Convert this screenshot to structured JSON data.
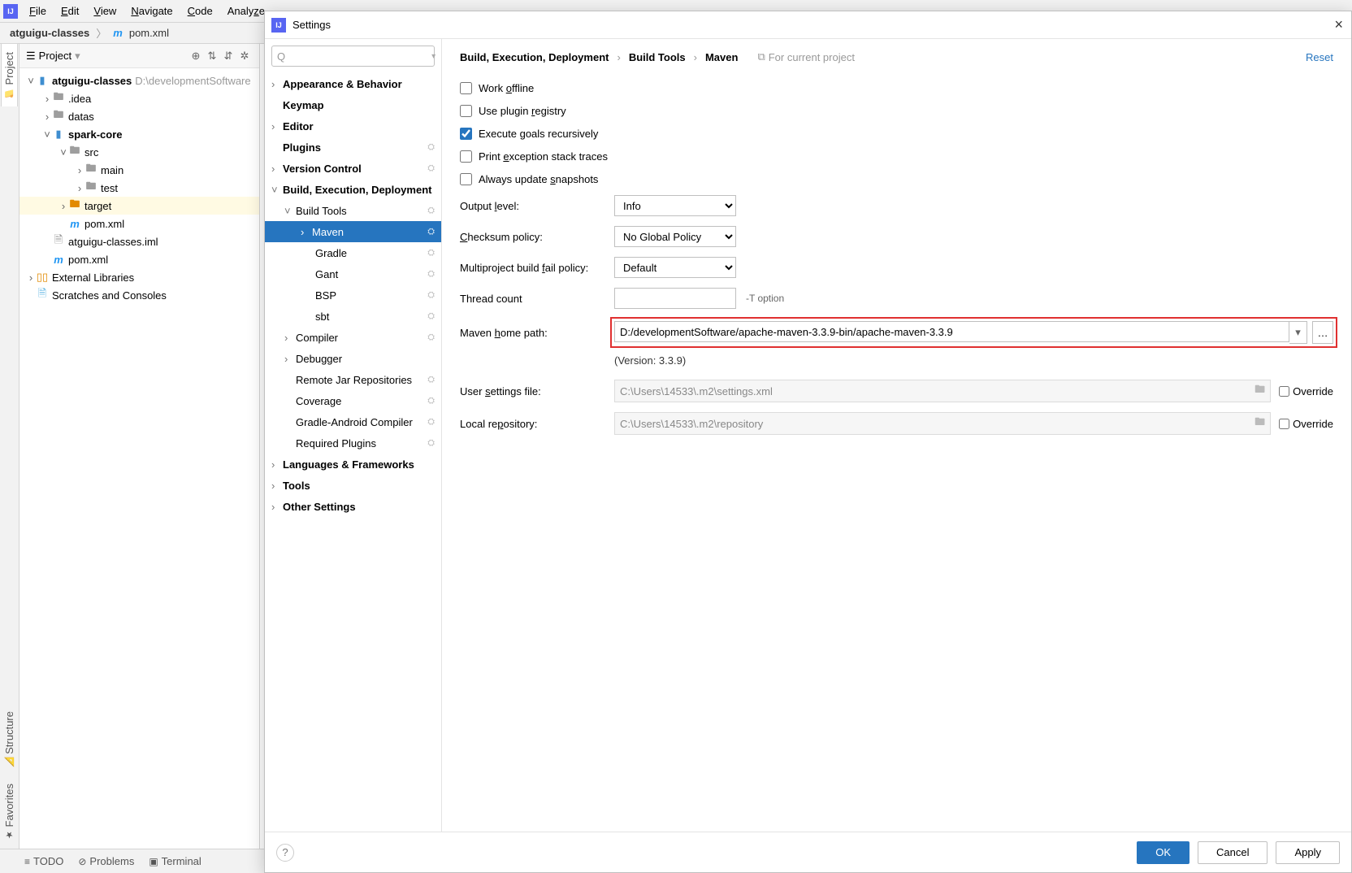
{
  "menubar": {
    "items": [
      "File",
      "Edit",
      "View",
      "Navigate",
      "Code",
      "Analyze"
    ]
  },
  "breadcrumb": {
    "project": "atguigu-classes",
    "file": "pom.xml"
  },
  "left_tabs": {
    "project": "Project",
    "structure": "Structure",
    "favorites": "Favorites"
  },
  "project_panel": {
    "title": "Project",
    "tree": {
      "root": "atguigu-classes",
      "root_path": "D:\\developmentSoftware",
      "idea": ".idea",
      "datas": "datas",
      "spark_core": "spark-core",
      "src": "src",
      "main": "main",
      "test": "test",
      "target": "target",
      "pom1": "pom.xml",
      "iml": "atguigu-classes.iml",
      "pom2": "pom.xml",
      "ext_lib": "External Libraries",
      "scratches": "Scratches and Consoles"
    }
  },
  "bottom": {
    "todo": "TODO",
    "problems": "Problems",
    "terminal": "Terminal"
  },
  "dialog": {
    "title": "Settings",
    "search_placeholder": "",
    "reset": "Reset",
    "proj_hint": "For current project",
    "crumbs": [
      "Build, Execution, Deployment",
      "Build Tools",
      "Maven"
    ],
    "tree": {
      "appearance": "Appearance & Behavior",
      "keymap": "Keymap",
      "editor": "Editor",
      "plugins": "Plugins",
      "vcs": "Version Control",
      "bed": "Build, Execution, Deployment",
      "build_tools": "Build Tools",
      "maven": "Maven",
      "gradle": "Gradle",
      "gant": "Gant",
      "bsp": "BSP",
      "sbt": "sbt",
      "compiler": "Compiler",
      "debugger": "Debugger",
      "remote_jar": "Remote Jar Repositories",
      "coverage": "Coverage",
      "gradle_android": "Gradle-Android Compiler",
      "required_plugins": "Required Plugins",
      "langs": "Languages & Frameworks",
      "tools": "Tools",
      "other": "Other Settings"
    },
    "checks": {
      "offline": "Work offline",
      "registry": "Use plugin registry",
      "recursive": "Execute goals recursively",
      "exception": "Print exception stack traces",
      "snapshots": "Always update snapshots"
    },
    "fields": {
      "output_level_label": "Output level:",
      "output_level": "Info",
      "checksum_label": "Checksum policy:",
      "checksum": "No Global Policy",
      "failpolicy_label": "Multiproject build fail policy:",
      "failpolicy": "Default",
      "thread_label": "Thread count",
      "thread": "",
      "thread_hint": "-T option",
      "maven_home_label": "Maven home path:",
      "maven_home": "D:/developmentSoftware/apache-maven-3.3.9-bin/apache-maven-3.3.9",
      "version": "(Version: 3.3.9)",
      "user_settings_label": "User settings file:",
      "user_settings": "C:\\Users\\14533\\.m2\\settings.xml",
      "local_repo_label": "Local repository:",
      "local_repo": "C:\\Users\\14533\\.m2\\repository",
      "override": "Override"
    },
    "buttons": {
      "ok": "OK",
      "cancel": "Cancel",
      "apply": "Apply"
    }
  }
}
